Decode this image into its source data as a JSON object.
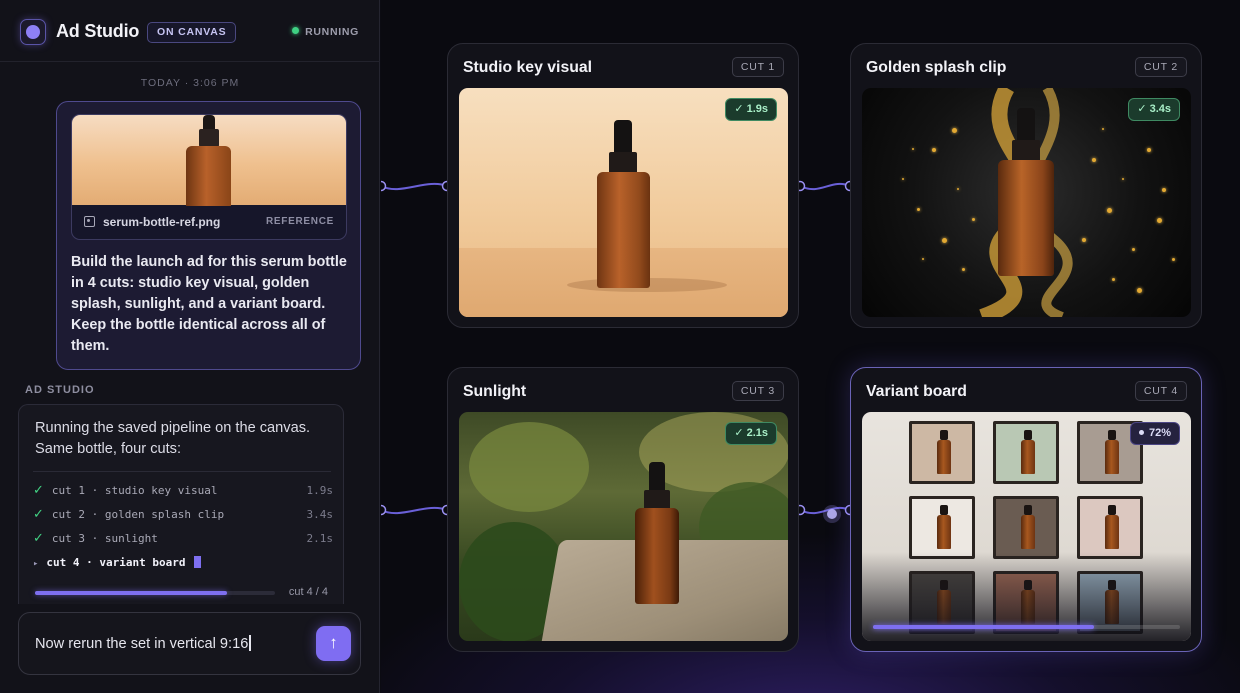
{
  "app": {
    "title": "Ad Studio",
    "canvas_badge": "ON CANVAS",
    "status": "RUNNING"
  },
  "chat": {
    "timestamp": "TODAY · 3:06 PM",
    "user_message": {
      "attachment": {
        "filename": "serum-bottle-ref.png",
        "tag": "REFERENCE"
      },
      "text": "Build the launch ad for this serum bottle in 4 cuts: studio key visual, golden splash, sunlight, and a variant board. Keep the bottle identical across all of them."
    },
    "assistant": {
      "label": "AD STUDIO",
      "text": "Running the saved pipeline on the canvas. Same bottle, four cuts:",
      "steps": [
        {
          "label": "cut 1 · studio key visual",
          "time": "1.9s"
        },
        {
          "label": "cut 2 · golden splash clip",
          "time": "3.4s"
        },
        {
          "label": "cut 3 · sunlight",
          "time": "2.1s"
        }
      ],
      "current_step": "cut 4 · variant board",
      "progress_label": "cut 4 / 4",
      "progress": 0.8
    },
    "input": {
      "value": "Now rerun the set in vertical 9:16"
    }
  },
  "canvas": {
    "cards": [
      {
        "title": "Studio key visual",
        "cut": "CUT 1",
        "badge": "✓ 1.9s"
      },
      {
        "title": "Golden splash clip",
        "cut": "CUT 2",
        "badge": "✓ 3.4s"
      },
      {
        "title": "Sunlight",
        "cut": "CUT 3",
        "badge": "✓ 2.1s"
      },
      {
        "title": "Variant board",
        "cut": "CUT 4",
        "badge": "72%",
        "progress": 0.72
      }
    ]
  },
  "colors": {
    "accent": "#7e6ff0",
    "success": "#42d283",
    "background": "#0b0b12"
  }
}
